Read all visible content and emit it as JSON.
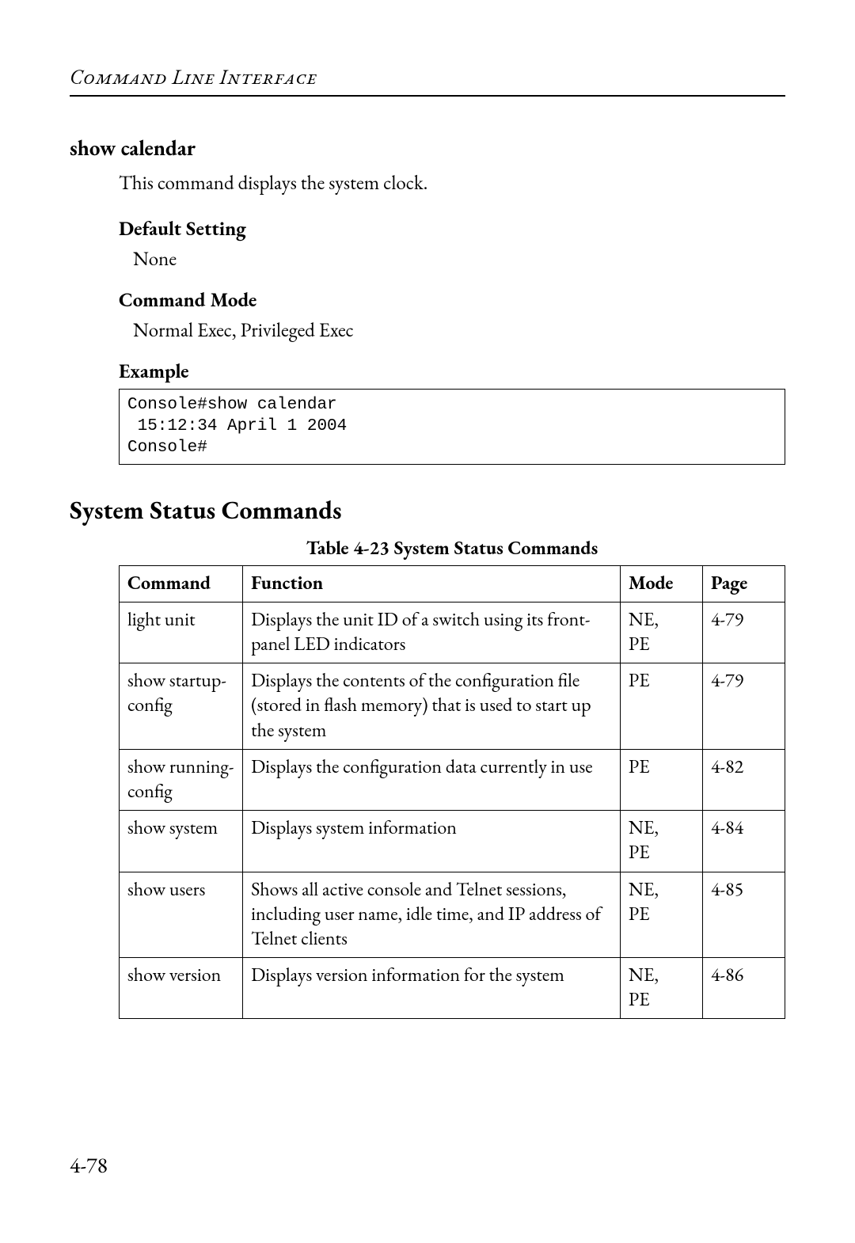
{
  "header": {
    "running_title": "Command Line Interface"
  },
  "show_calendar": {
    "heading": "show calendar",
    "intro": "This command displays the system clock.",
    "default_setting_label": "Default Setting",
    "default_setting_value": "None",
    "command_mode_label": "Command Mode",
    "command_mode_value": "Normal Exec, Privileged Exec",
    "example_label": "Example",
    "example_code": "Console#show calendar\n 15:12:34 April 1 2004\nConsole#"
  },
  "status_section": {
    "heading": "System Status Commands",
    "table_caption": "Table 4-23  System Status Commands",
    "columns": {
      "command": "Command",
      "function": "Function",
      "mode": "Mode",
      "page": "Page"
    },
    "rows": [
      {
        "command": "light unit",
        "function": "Displays the unit ID of a switch using its front-panel LED indicators",
        "mode": "NE,\nPE",
        "page": "4-79"
      },
      {
        "command": "show startup-config",
        "function": "Displays the contents of the configuration file (stored in flash memory) that is used to start up the system",
        "mode": "PE",
        "page": "4-79"
      },
      {
        "command": "show running-config",
        "function": "Displays the configuration data currently in use",
        "mode": "PE",
        "page": "4-82"
      },
      {
        "command": "show system",
        "function": "Displays system information",
        "mode": "NE,\nPE",
        "page": "4-84"
      },
      {
        "command": "show users",
        "function": "Shows all active console and Telnet sessions, including user name, idle time, and IP address of Telnet clients",
        "mode": "NE,\nPE",
        "page": "4-85"
      },
      {
        "command": "show version",
        "function": "Displays version information for the system",
        "mode": "NE,\nPE",
        "page": "4-86"
      }
    ]
  },
  "page_number": "4-78"
}
